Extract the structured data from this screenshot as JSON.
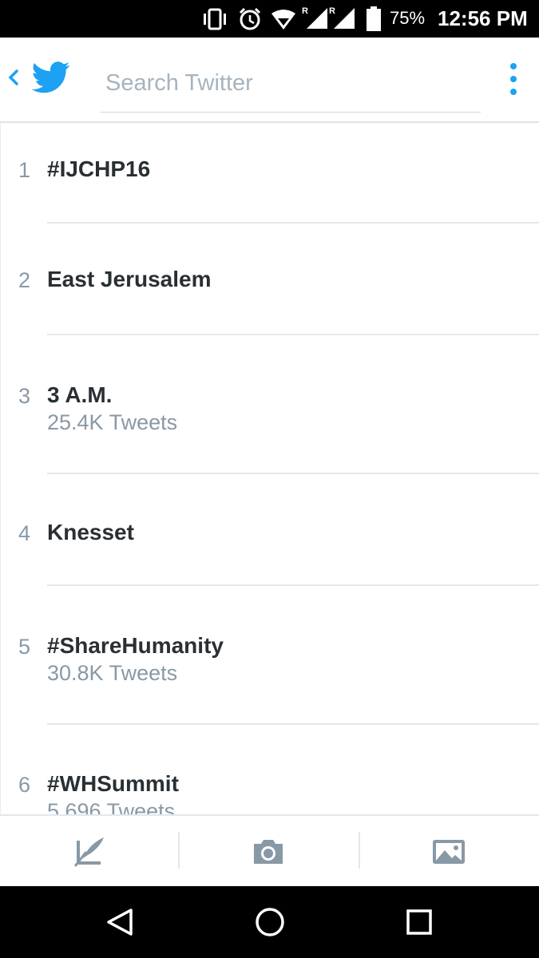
{
  "status_bar": {
    "battery_percent": "75%",
    "time": "12:56 PM",
    "icons": [
      "vibrate-icon",
      "alarm-icon",
      "wifi-icon",
      "signal-icon",
      "signal-icon",
      "battery-icon"
    ]
  },
  "header": {
    "search_placeholder": "Search Twitter",
    "icons": [
      "back-icon",
      "twitter-bird-icon",
      "overflow-menu-icon"
    ]
  },
  "trends": [
    {
      "rank": "1",
      "name": "#IJCHP16",
      "count": ""
    },
    {
      "rank": "2",
      "name": "East Jerusalem",
      "count": ""
    },
    {
      "rank": "3",
      "name": "3 A.M.",
      "count": "25.4K Tweets"
    },
    {
      "rank": "4",
      "name": "Knesset",
      "count": ""
    },
    {
      "rank": "5",
      "name": "#ShareHumanity",
      "count": "30.8K Tweets"
    },
    {
      "rank": "6",
      "name": "#WHSummit",
      "count": "5,696 Tweets"
    }
  ],
  "toolbar": {
    "icons": [
      "compose-tweet-icon",
      "camera-icon",
      "gallery-icon"
    ]
  },
  "navbar": {
    "icons": [
      "back-triangle-icon",
      "home-circle-icon",
      "recents-square-icon"
    ]
  },
  "colors": {
    "accent": "#1da1f2",
    "text_primary": "#292f33",
    "text_secondary": "#8899a6",
    "divider": "#e1e8ed"
  }
}
